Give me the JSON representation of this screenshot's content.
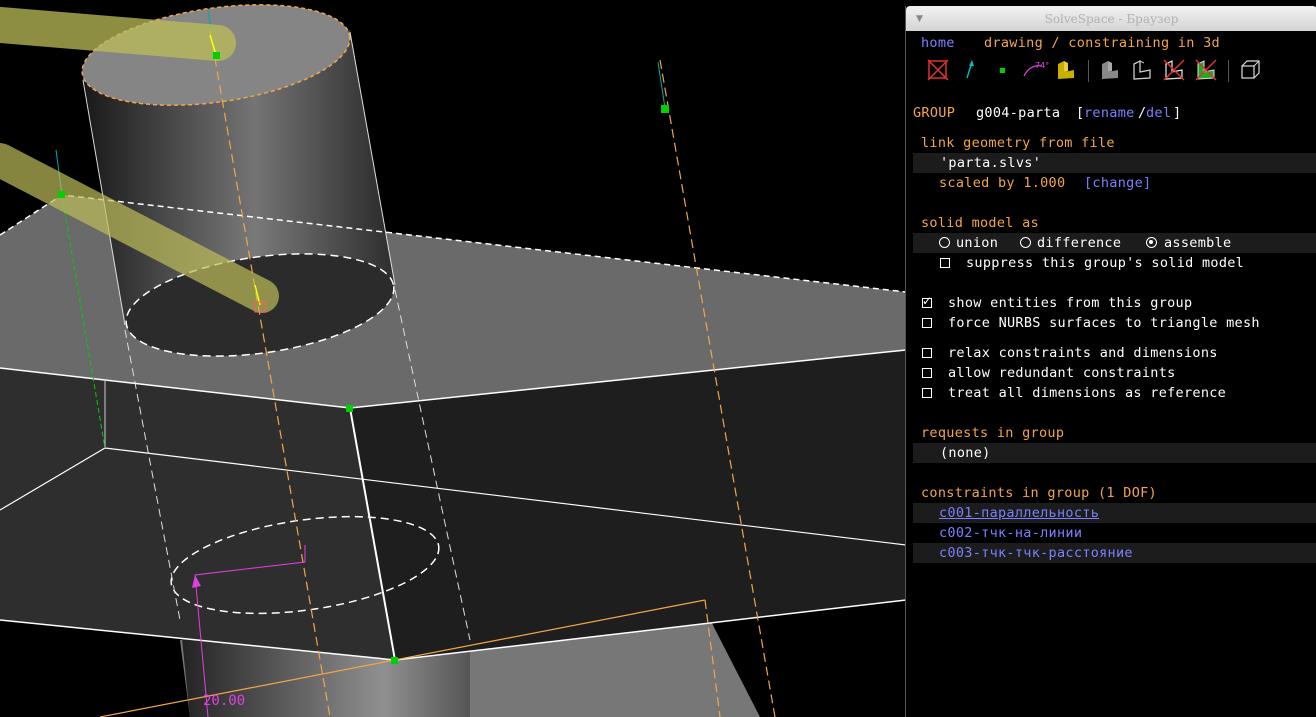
{
  "window": {
    "title": "SolveSpace - Браузер"
  },
  "nav": {
    "home": "home",
    "breadcrumb": "drawing / constraining in 3d"
  },
  "toolbar": {
    "angle_label": "74°",
    "icons": [
      "hide-all-icon",
      "workplane-normal-icon",
      "point-icon",
      "angle-icon",
      "extrude-icon",
      "solid-icon",
      "group-solid-icon",
      "hidden-line-icon",
      "outline-icon",
      "wireframe-icon"
    ]
  },
  "group": {
    "heading": "GROUP",
    "name": "g004-parta",
    "open_bracket": "[",
    "rename": "rename",
    "slash": "/",
    "del": "del",
    "close_bracket": "]"
  },
  "link": {
    "heading": "link geometry from file",
    "file": "'parta.slvs'",
    "scaled_label": "scaled by 1.000",
    "change": "[change]"
  },
  "solid_model": {
    "heading": "solid model as",
    "options": [
      {
        "label": "union",
        "checked": false
      },
      {
        "label": "difference",
        "checked": false
      },
      {
        "label": "assemble",
        "checked": true
      }
    ],
    "suppress": {
      "label": "suppress this group's solid model",
      "checked": false
    }
  },
  "options": [
    {
      "label": "show entities from this group",
      "checked": true
    },
    {
      "label": "force NURBS surfaces to triangle mesh",
      "checked": false
    },
    {
      "label": "relax constraints and dimensions",
      "checked": false
    },
    {
      "label": "allow redundant constraints",
      "checked": false
    },
    {
      "label": "treat all dimensions as reference",
      "checked": false
    }
  ],
  "requests": {
    "heading": "requests in group",
    "none": "(none)"
  },
  "constraints": {
    "heading": "constraints in group (1 DOF)",
    "items": [
      "c001-параллельность",
      "c002-тчк-на-линии",
      "c003-тчк-тчк-расстояние"
    ]
  },
  "viewport": {
    "dimension_label": "20.00"
  },
  "colors": {
    "orange": "#f2a54a",
    "link_blue": "#7b80ff",
    "selection_green": "#00d000",
    "dimension_magenta": "#e040e0"
  }
}
